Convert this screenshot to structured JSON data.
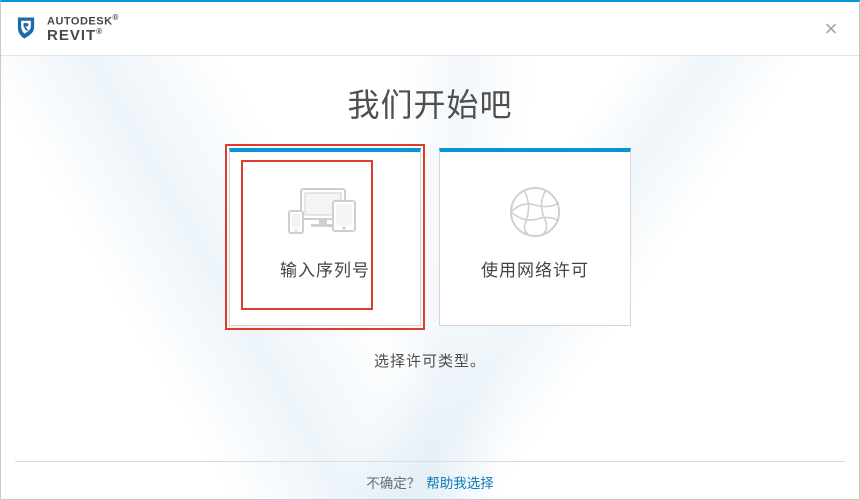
{
  "brand": {
    "top": "AUTODESK",
    "top_mark": "®",
    "bottom": "REVIT",
    "bottom_mark": "®"
  },
  "heading": "我们开始吧",
  "cards": [
    {
      "label": "输入序列号",
      "highlighted": true
    },
    {
      "label": "使用网络许可",
      "highlighted": false
    }
  ],
  "subtext": "选择许可类型。",
  "footer": {
    "prompt": "不确定？",
    "link_text": "帮助我选择"
  }
}
